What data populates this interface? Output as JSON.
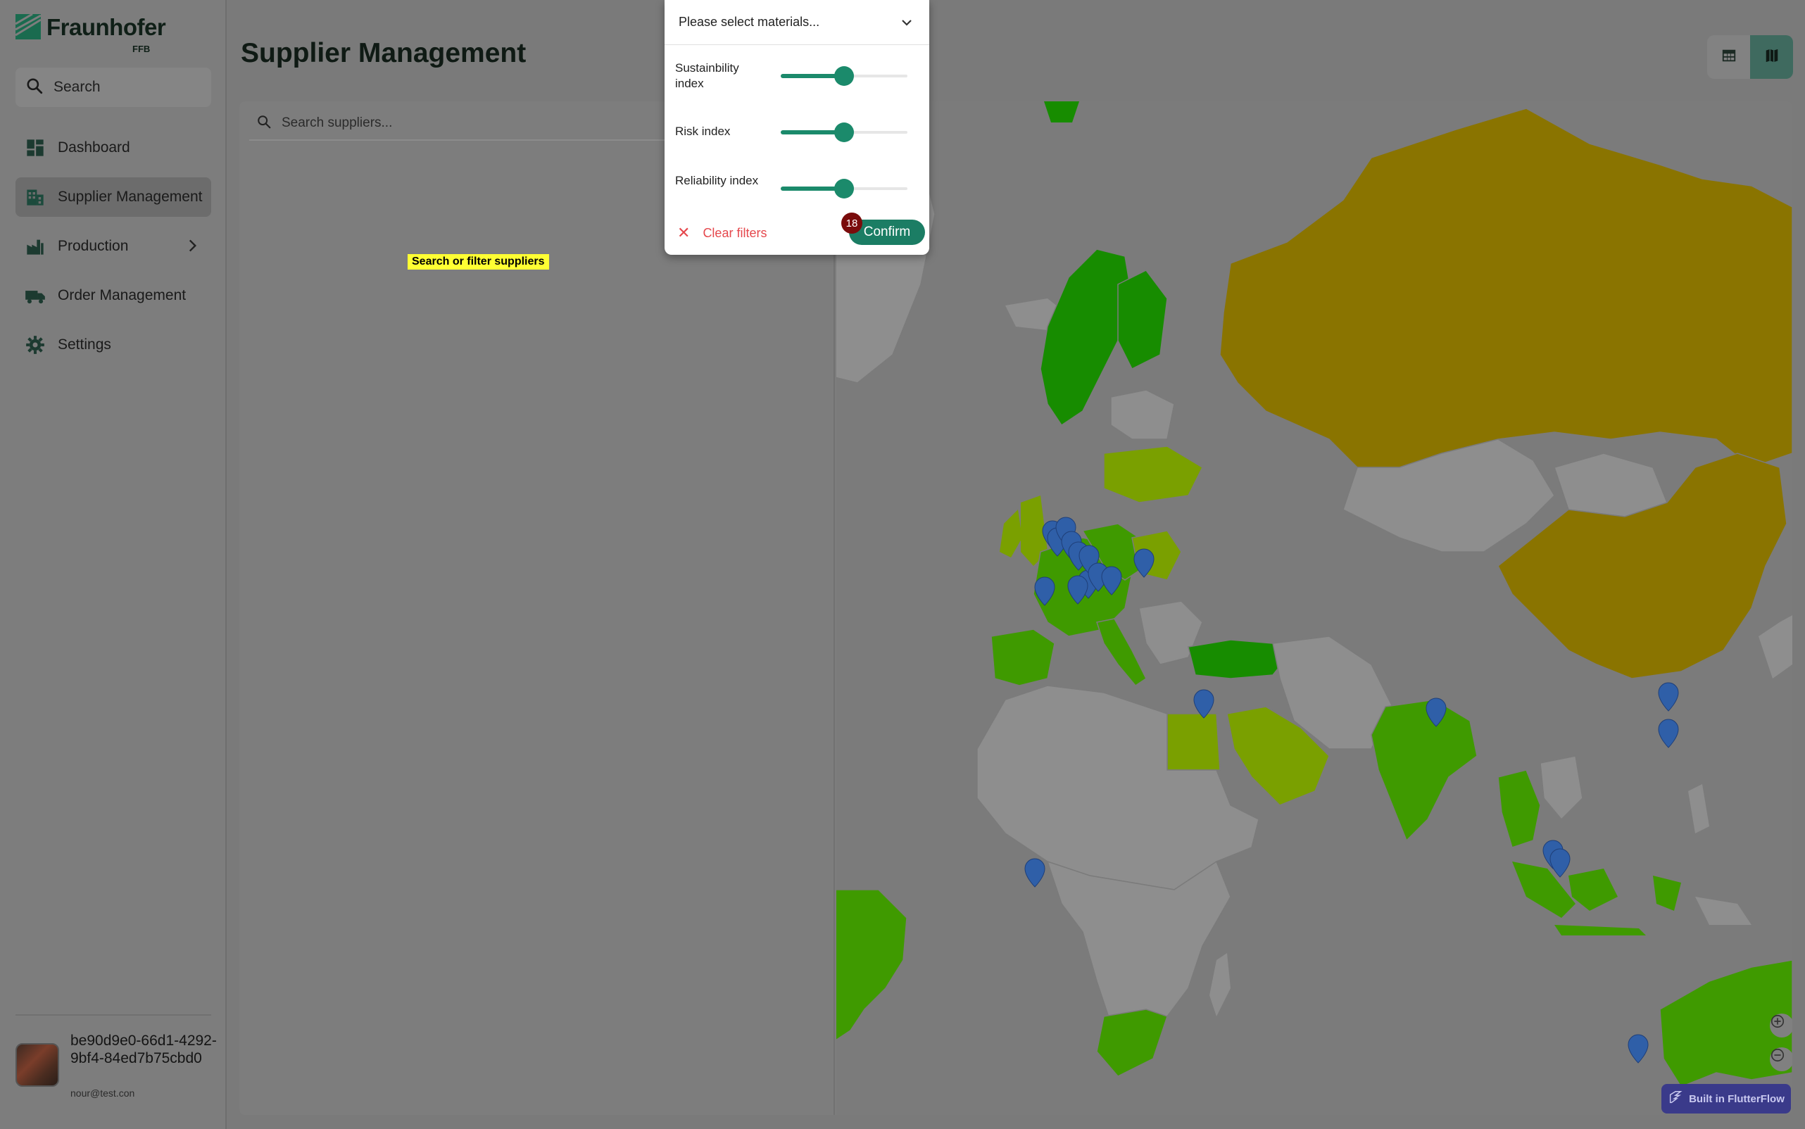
{
  "brand": {
    "name": "Fraunhofer",
    "sub": "FFB"
  },
  "sidebar": {
    "search_label": "Search",
    "items": [
      {
        "label": "Dashboard",
        "icon": "dashboard-icon"
      },
      {
        "label": "Supplier Management",
        "icon": "building-icon",
        "active": true
      },
      {
        "label": "Production",
        "icon": "factory-icon",
        "has_submenu": true
      },
      {
        "label": "Order Management",
        "icon": "truck-icon"
      },
      {
        "label": "Settings",
        "icon": "gear-icon"
      }
    ]
  },
  "user": {
    "id": "be90d9e0-66d1-4292-9bf4-84ed7b75cbd0",
    "email": "nour@test.con"
  },
  "header": {
    "title": "Supplier Management"
  },
  "view_toggle": {
    "options": [
      "table-view-icon",
      "map-view-icon"
    ],
    "selected": "map-view-icon"
  },
  "suppliers": {
    "search_placeholder": "Search suppliers...",
    "empty_hint": "Search or filter suppliers"
  },
  "filter": {
    "material_placeholder": "Please select materials...",
    "sliders": [
      {
        "label": "Sustainbility index",
        "value": 0.5
      },
      {
        "label": "Risk index",
        "value": 0.5
      },
      {
        "label": "Reliability index",
        "value": 0.5
      }
    ],
    "clear_label": "Clear filters",
    "confirm_label": "Confirm",
    "count_badge": "18"
  },
  "footer": {
    "builtin_label": "Built in FlutterFlow"
  },
  "colors": {
    "accent": "#1b8a6b",
    "map_green_dark": "#178c00",
    "map_green": "#3f9a00",
    "map_yellowgreen": "#7aa000",
    "map_olive": "#8a7400",
    "map_grey": "#8e8e8e",
    "pin_blue": "#2f5fa8"
  }
}
